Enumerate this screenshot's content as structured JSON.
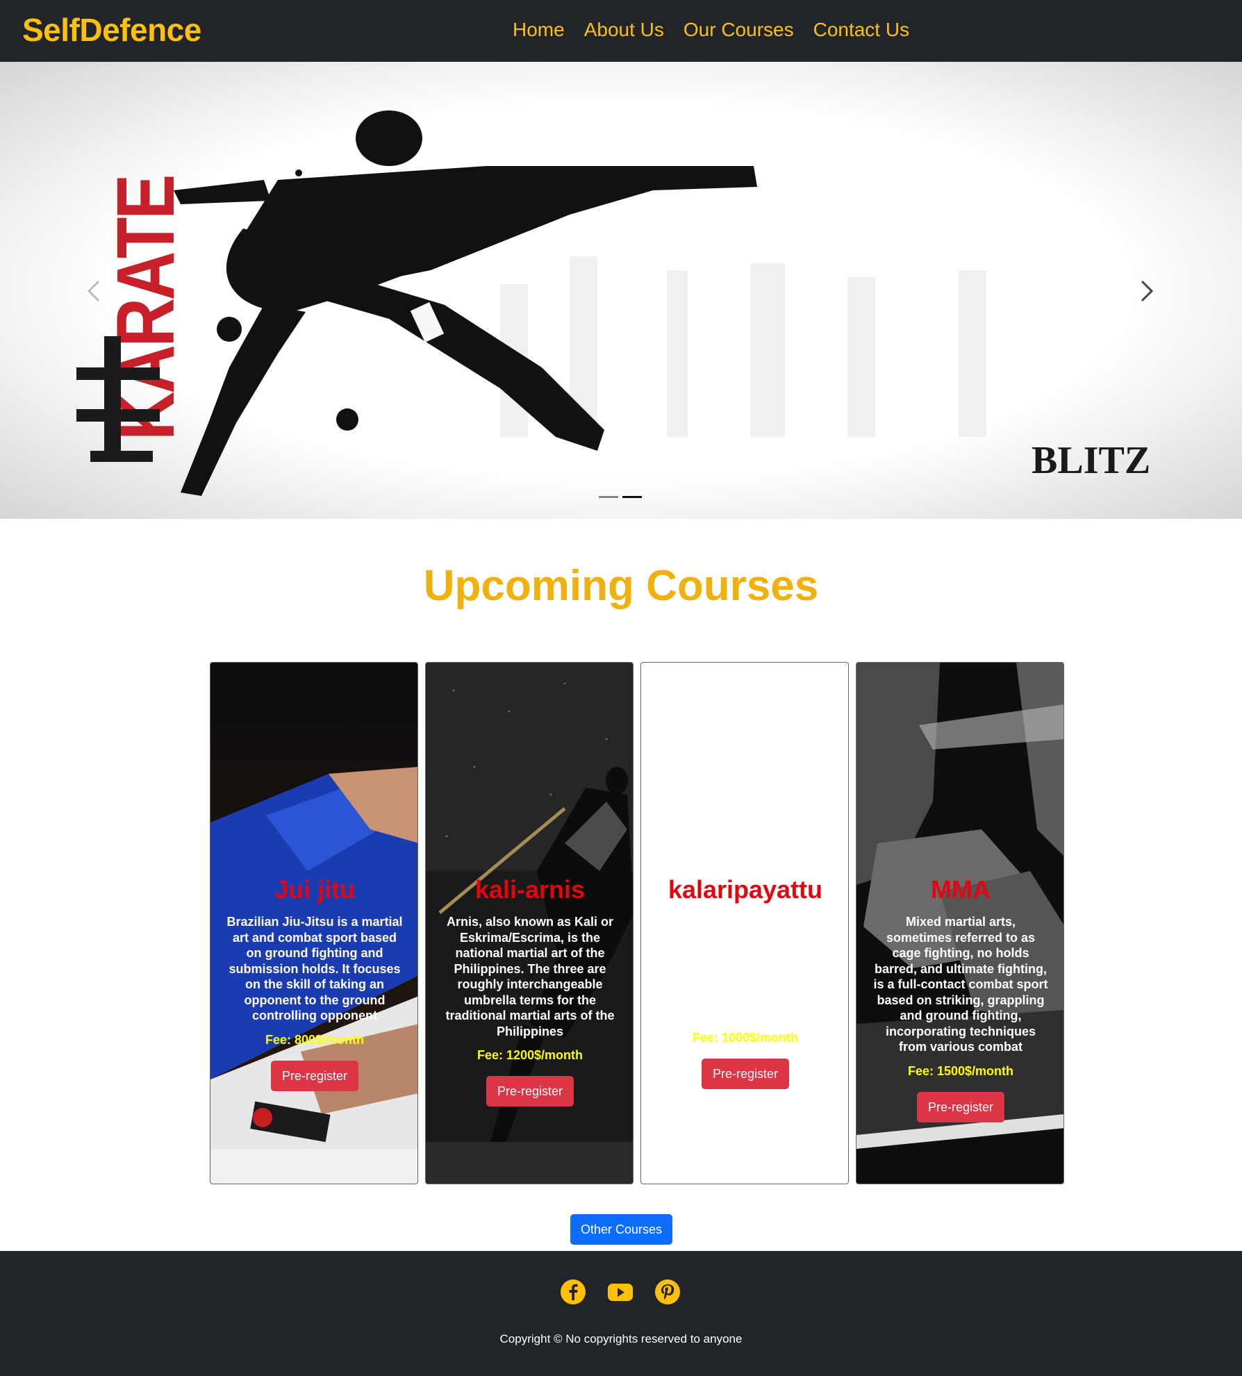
{
  "navbar": {
    "brand": "SelfDefence",
    "links": [
      "Home",
      "About Us",
      "Our Courses",
      "Contact Us"
    ]
  },
  "carousel": {
    "slide_text_vertical": "KARATE",
    "slide_kanji": "空手",
    "slide_logo": "BLITZ",
    "prev_icon": "chevron-left-icon",
    "next_icon": "chevron-right-icon",
    "slides_total": 2,
    "active_slide": 2
  },
  "section": {
    "title": "Upcoming Courses"
  },
  "courses": [
    {
      "title": "Jui jitu",
      "text": "Brazilian Jiu-Jitsu is a martial art and combat sport based on ground fighting and submission holds. It focuses on the skill of taking an opponent to the ground controlling opponent",
      "fee": "Fee: 800$/month",
      "button": "Pre-register"
    },
    {
      "title": "kali-arnis",
      "text": "Arnis, also known as Kali or Eskrima/Escrima, is the national martial art of the Philippines. The three are roughly interchangeable umbrella terms for the traditional martial arts of the Philippines",
      "fee": "Fee: 1200$/month",
      "button": "Pre-register"
    },
    {
      "title": "kalaripayattu",
      "text": "",
      "fee": "Fee: 1000$/month",
      "button": "Pre-register"
    },
    {
      "title": "MMA",
      "text": "Mixed martial arts, sometimes referred to as cage fighting, no holds barred, and ultimate fighting, is a full-contact combat sport based on striking, grappling and ground fighting, incorporating techniques from various combat",
      "fee": "Fee: 1500$/month",
      "button": "Pre-register"
    }
  ],
  "other_courses_button": "Other Courses",
  "footer": {
    "social_icons": [
      "facebook-icon",
      "youtube-icon",
      "pinterest-icon"
    ],
    "copyright": "Copyright © No copyrights reserved to anyone"
  },
  "colors": {
    "navbar_bg": "#212529",
    "accent": "#ffc107",
    "title": "#f0b10e",
    "card_title": "#e3060f",
    "fee": "#ffff00",
    "btn_red": "#dc3545",
    "btn_blue": "#0d6efd"
  }
}
